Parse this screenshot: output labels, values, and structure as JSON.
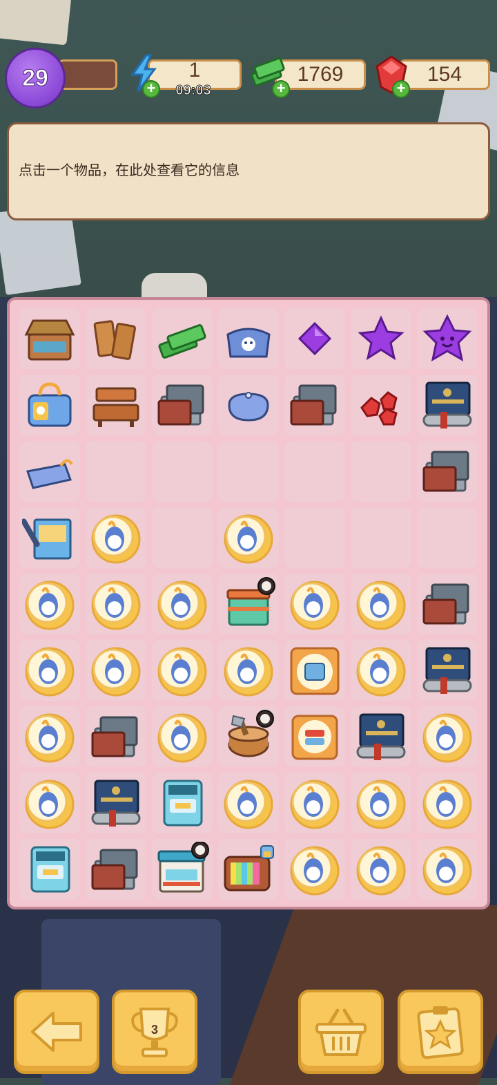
{
  "hud": {
    "level": "29",
    "energy": "1",
    "energy_timer": "09:03",
    "cash": "1769",
    "gems": "154"
  },
  "info_panel": {
    "text": "点击一个物品，在此处查看它的信息"
  },
  "board": {
    "rows": 9,
    "cols": 7,
    "cells": [
      [
        "market-stall",
        "wood-planks",
        "cash-stack",
        "blue-pouch",
        "purple-gem",
        "purple-star",
        "smiley-star"
      ],
      [
        "bunny-bag",
        "wooden-bench",
        "diploma-books",
        "small-coin-purse",
        "diploma-books",
        "ruby-cluster",
        "degree-certificate"
      ],
      [
        "blue-handbag",
        "empty",
        "empty",
        "empty",
        "empty",
        "empty",
        "diploma-books"
      ],
      [
        "notebook-pen",
        "gold-bunny-token",
        "empty",
        "gold-bunny-token",
        "empty",
        "empty",
        "empty"
      ],
      [
        "gold-bunny-token",
        "gold-bunny-token",
        "gold-bunny-token",
        "cake-shop-timer",
        "gold-bunny-token",
        "gold-bunny-token",
        "diploma-books"
      ],
      [
        "gold-bunny-token",
        "gold-bunny-token",
        "gold-bunny-token",
        "gold-bunny-token",
        "gold-jeans-box",
        "gold-bunny-token",
        "degree-certificate"
      ],
      [
        "gold-bunny-token",
        "diploma-books",
        "gold-bunny-token",
        "stump-axe-timer",
        "gold-clothes-box",
        "degree-certificate",
        "gold-bunny-token"
      ],
      [
        "gold-bunny-token",
        "degree-certificate",
        "atm-machine",
        "gold-bunny-token",
        "gold-bunny-token",
        "gold-bunny-token",
        "gold-bunny-token"
      ],
      [
        "atm-machine",
        "diploma-books",
        "store-24h-timer",
        "retro-tv-lock",
        "gold-bunny-token",
        "gold-bunny-token",
        "gold-bunny-token"
      ]
    ]
  },
  "buttons": {
    "trophy_count": "3"
  },
  "colors": {
    "board_bg": "#f4c6cf",
    "cell_bg": "#f0cdd4",
    "button_yellow": "#f9c85c",
    "panel_bg": "#f1e1c7"
  }
}
